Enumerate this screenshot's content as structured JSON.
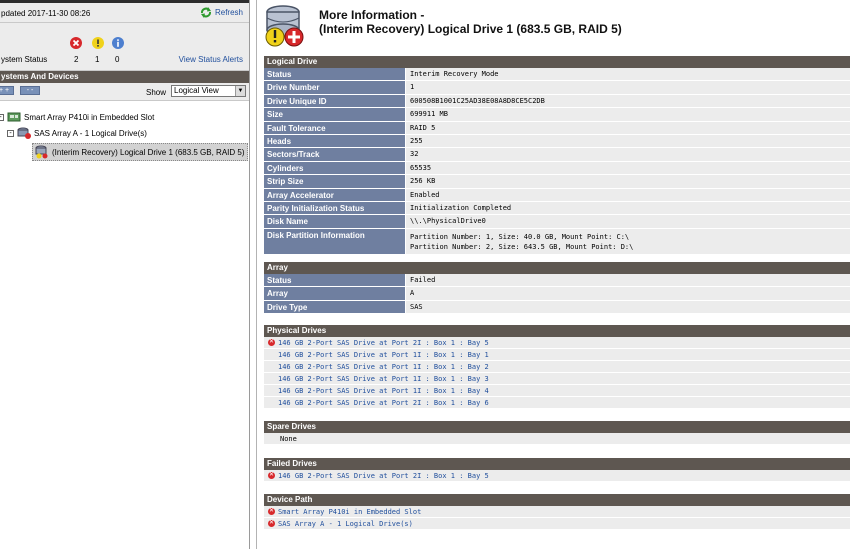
{
  "left": {
    "updated": "pdated 2017-11-30 08:26",
    "refresh_label": "Refresh",
    "status_label": "ystem Status",
    "counts": {
      "critical": "2",
      "warning": "1",
      "info": "0"
    },
    "view_alerts": "View Status Alerts",
    "systems_header": "ystems And Devices",
    "show_label": "Show",
    "view_select": "Logical View",
    "tree": [
      "Smart Array P410i in Embedded Slot",
      "SAS Array A - 1 Logical Drive(s)",
      "(Interim Recovery) Logical Drive 1 (683.5 GB, RAID 5)"
    ]
  },
  "right": {
    "title_line1": "More Information -",
    "title_line2": "(Interim Recovery) Logical Drive 1 (683.5 GB, RAID 5)",
    "logical_drive": {
      "header": "Logical Drive",
      "rows": [
        {
          "k": "Status",
          "v": "Interim Recovery Mode"
        },
        {
          "k": "Drive Number",
          "v": "1"
        },
        {
          "k": "Drive Unique ID",
          "v": "600508B1001C25AD38E08A8D8CE5C2DB"
        },
        {
          "k": "Size",
          "v": "699911 MB"
        },
        {
          "k": "Fault Tolerance",
          "v": "RAID 5"
        },
        {
          "k": "Heads",
          "v": "255"
        },
        {
          "k": "Sectors/Track",
          "v": "32"
        },
        {
          "k": "Cylinders",
          "v": "65535"
        },
        {
          "k": "Strip Size",
          "v": "256 KB"
        },
        {
          "k": "Array Accelerator",
          "v": "Enabled"
        },
        {
          "k": "Parity Initialization Status",
          "v": "Initialization Completed"
        },
        {
          "k": "Disk Name",
          "v": "\\\\.\\PhysicalDrive0"
        }
      ],
      "partition_label": "Disk Partition Information",
      "partition_line1": "Partition Number: 1, Size: 40.0 GB, Mount Point: C:\\",
      "partition_line2": "Partition Number: 2, Size: 643.5 GB, Mount Point: D:\\"
    },
    "array": {
      "header": "Array",
      "rows": [
        {
          "k": "Status",
          "v": "Failed"
        },
        {
          "k": "Array",
          "v": "A"
        },
        {
          "k": "Drive Type",
          "v": "SAS"
        }
      ]
    },
    "physical_drives": {
      "header": "Physical Drives",
      "items": [
        "146 GB 2-Port SAS Drive at Port 2I : Box 1 : Bay 5",
        "146 GB 2-Port SAS Drive at Port 1I : Box 1 : Bay 1",
        "146 GB 2-Port SAS Drive at Port 1I : Box 1 : Bay 2",
        "146 GB 2-Port SAS Drive at Port 1I : Box 1 : Bay 3",
        "146 GB 2-Port SAS Drive at Port 1I : Box 1 : Bay 4",
        "146 GB 2-Port SAS Drive at Port 2I : Box 1 : Bay 6"
      ]
    },
    "spare_drives": {
      "header": "Spare Drives",
      "none": "None"
    },
    "failed_drives": {
      "header": "Failed Drives",
      "items": [
        "146 GB 2-Port SAS Drive at Port 2I : Box 1 : Bay 5"
      ]
    },
    "device_path": {
      "header": "Device Path",
      "items": [
        "Smart Array P410i in Embedded Slot",
        "SAS Array A - 1 Logical Drive(s)"
      ]
    }
  }
}
